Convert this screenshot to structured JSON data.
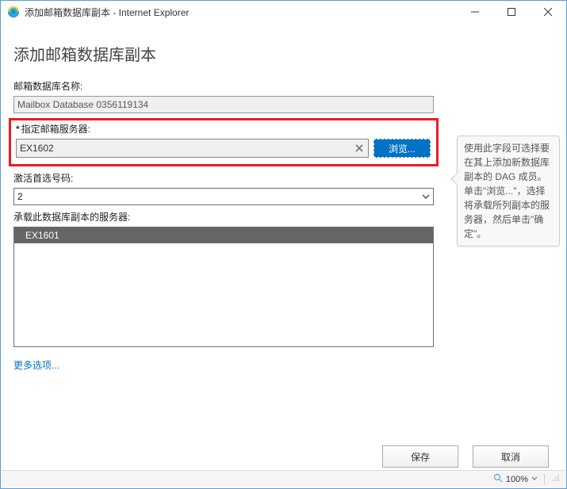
{
  "window": {
    "title": "添加邮箱数据库副本 - Internet Explorer"
  },
  "page": {
    "heading": "添加邮箱数据库副本"
  },
  "fields": {
    "dbname_label": "邮箱数据库名称:",
    "dbname_value": "Mailbox Database 0356119134",
    "server_label": "指定邮箱服务器:",
    "server_value": "EX1602",
    "browse_label": "浏览...",
    "activation_label": "激活首选号码:",
    "activation_value": "2",
    "hosts_label": "承载此数据库副本的服务器:",
    "hosts": [
      "EX1601"
    ],
    "more_options": "更多选项..."
  },
  "callout": {
    "text": "使用此字段可选择要在其上添加新数据库副本的 DAG 成员。单击\"浏览...\"，选择将承载所列副本的服务器，然后单击\"确定\"。"
  },
  "footer": {
    "save": "保存",
    "cancel": "取消"
  },
  "statusbar": {
    "zoom": "100%"
  }
}
